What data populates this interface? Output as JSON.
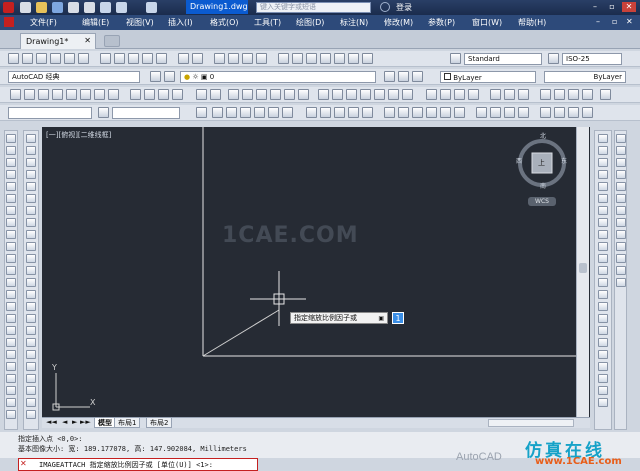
{
  "app": {
    "doc_title": "Drawing1.dwg",
    "search_placeholder": "键入关键字或短语",
    "user_label": "登录",
    "window_controls": [
      "–",
      "▫",
      "✕"
    ]
  },
  "menu": [
    "文件(F)",
    "编辑(E)",
    "视图(V)",
    "插入(I)",
    "格式(O)",
    "工具(T)",
    "绘图(D)",
    "标注(N)",
    "修改(M)",
    "参数(P)",
    "窗口(W)",
    "帮助(H)"
  ],
  "tabs": {
    "doc_tab": "Drawing1*"
  },
  "toolbar": {
    "text_style": "Standard",
    "dim_style": "ISO-25",
    "workspace": "AutoCAD 经典",
    "layer": "0",
    "color": "ByLayer",
    "linetype": "ByLayer"
  },
  "viewport": {
    "label": "[一][俯视][二维线框]",
    "watermark": "1CAE.COM",
    "prompt": "指定缩放比例因子或",
    "prompt_value": "1",
    "axis_y": "Y",
    "axis_x": "X",
    "wcs": "WCS",
    "compass": {
      "n": "北",
      "s": "南",
      "e": "东",
      "w": "西",
      "top": "上"
    }
  },
  "layout_tabs": [
    "模型",
    "布局1",
    "布局2"
  ],
  "command": {
    "history_1": "指定插入点 <0,0>:",
    "history_2": "基本图像大小: 宽: 189.177078, 高: 147.902084, Millimeters",
    "current": "IMAGEATTACH 指定缩放比例因子或 [单位(U)] <1>:"
  },
  "brand": {
    "text": "仿真在线",
    "url_text": "www.1CAE.com",
    "faint": "AutoCAD"
  },
  "colors": {
    "accent": "#0b5bd0",
    "canvas": "#262b34",
    "command_border": "#c42020"
  }
}
